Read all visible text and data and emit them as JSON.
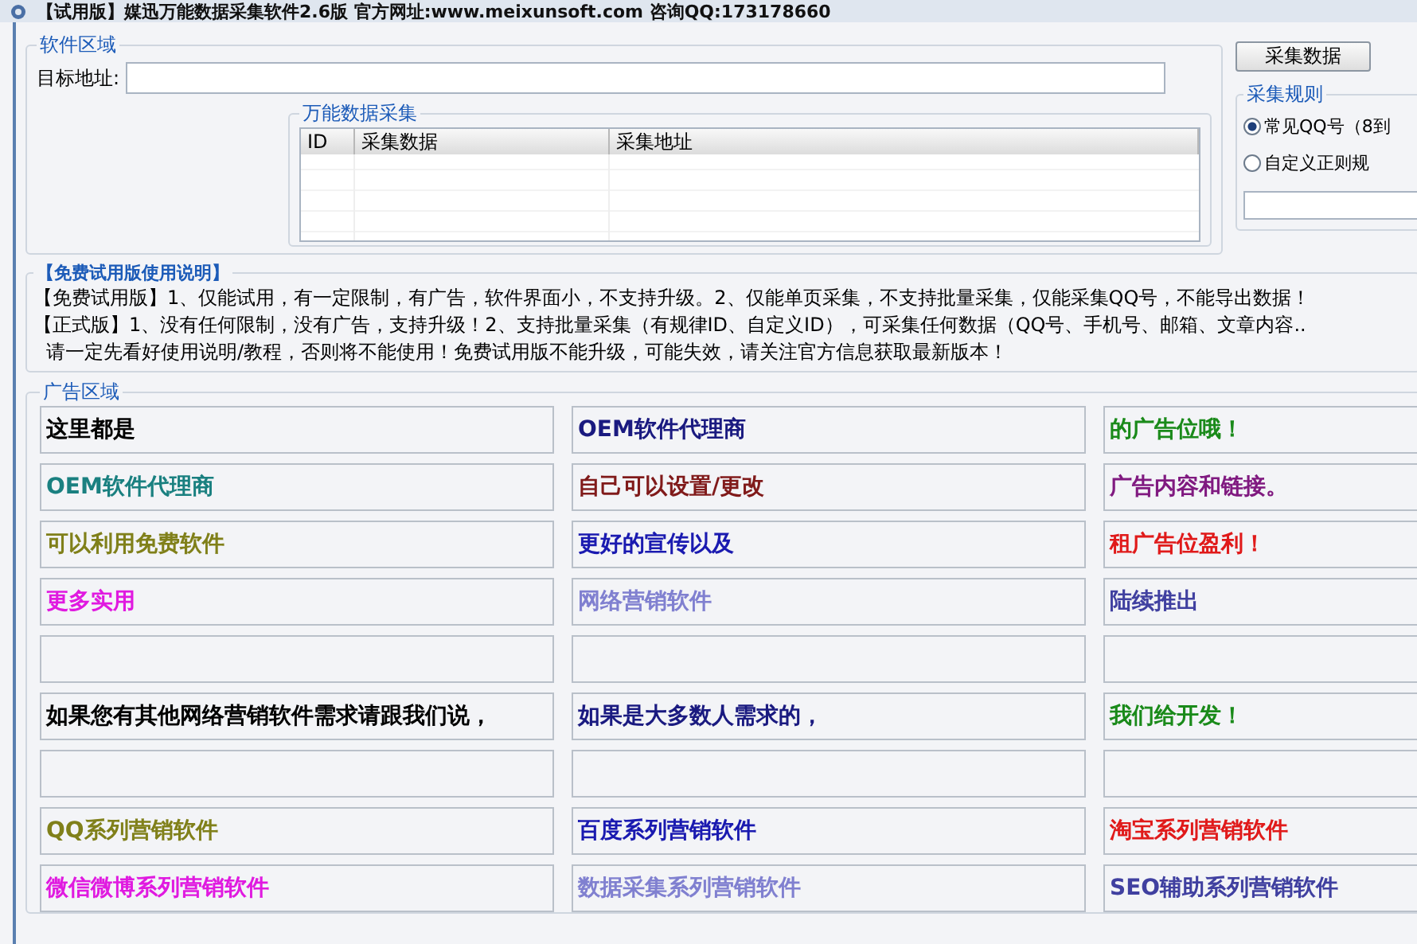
{
  "window": {
    "title": "【试用版】媒迅万能数据采集软件2.6版  官方网址:www.meixunsoft.com  咨询QQ:173178660"
  },
  "software_area": {
    "legend": "软件区域",
    "target_label": "目标地址:",
    "collector": {
      "legend": "万能数据采集",
      "columns": [
        "ID",
        "采集数据",
        "采集地址"
      ]
    }
  },
  "collect_button": "采集数据",
  "rules": {
    "legend": "采集规则",
    "options": [
      {
        "label": "常见QQ号（8到",
        "selected": true
      },
      {
        "label": "自定义正则规",
        "selected": false
      }
    ]
  },
  "instructions": {
    "legend": "【免费试用版使用说明】",
    "lines": [
      "【免费试用版】1、仅能试用，有一定限制，有广告，软件界面小，不支持升级。2、仅能单页采集，不支持批量采集，仅能采集QQ号，不能导出数据！",
      "【正式版】1、没有任何限制，没有广告，支持升级！2、支持批量采集（有规律ID、自定义ID），可采集任何数据（QQ号、手机号、邮箱、文章内容..",
      "请一定先看好使用说明/教程，否则将不能使用！免费试用版不能升级，可能失效，请关注官方信息获取最新版本！"
    ]
  },
  "ad_area": {
    "legend": "广告区域",
    "rows": [
      [
        {
          "kind": "text",
          "text": "这里都是",
          "color": "#000000"
        },
        {
          "kind": "text",
          "text": "OEM软件代理商",
          "color": "#1a1a80"
        },
        {
          "kind": "text",
          "text": "的广告位哦！",
          "color": "#1a8a1a"
        }
      ],
      [
        {
          "kind": "text",
          "text": "OEM软件代理商",
          "color": "#1a8080"
        },
        {
          "kind": "text",
          "text": "自己可以设置/更改",
          "color": "#801a1a"
        },
        {
          "kind": "text",
          "text": "广告内容和链接。",
          "color": "#801a80"
        }
      ],
      [
        {
          "kind": "text",
          "text": "可以利用免费软件",
          "color": "#80801a"
        },
        {
          "kind": "text",
          "text": "更好的宣传以及",
          "color": "#1a1ab0"
        },
        {
          "kind": "text",
          "text": "租广告位盈利！",
          "color": "#e01a1a"
        }
      ],
      [
        {
          "kind": "text",
          "text": "更多实用",
          "color": "#e01ae0"
        },
        {
          "kind": "text",
          "text": "网络营销软件",
          "color": "#8080d0"
        },
        {
          "kind": "text",
          "text": "陆续推出",
          "color": "#4040a0"
        }
      ],
      [
        {
          "kind": "empty"
        },
        {
          "kind": "empty"
        },
        {
          "kind": "empty"
        }
      ],
      [
        {
          "kind": "text",
          "text": "如果您有其他网络营销软件需求请跟我们说，",
          "color": "#000000"
        },
        {
          "kind": "text",
          "text": "如果是大多数人需求的，",
          "color": "#1a1a80"
        },
        {
          "kind": "text",
          "text": "我们给开发！",
          "color": "#1a8a1a"
        }
      ],
      [
        {
          "kind": "empty"
        },
        {
          "kind": "empty"
        },
        {
          "kind": "empty"
        }
      ],
      [
        {
          "kind": "text",
          "text": "QQ系列营销软件",
          "color": "#80801a"
        },
        {
          "kind": "text",
          "text": "百度系列营销软件",
          "color": "#1a1ab0"
        },
        {
          "kind": "text",
          "text": "淘宝系列营销软件",
          "color": "#e01a1a"
        }
      ],
      [
        {
          "kind": "text",
          "text": "微信微博系列营销软件",
          "color": "#e01ae0"
        },
        {
          "kind": "text",
          "text": "数据采集系列营销软件",
          "color": "#8080d0"
        },
        {
          "kind": "text",
          "text": "SEO辅助系列营销软件",
          "color": "#4040a0"
        }
      ]
    ]
  }
}
